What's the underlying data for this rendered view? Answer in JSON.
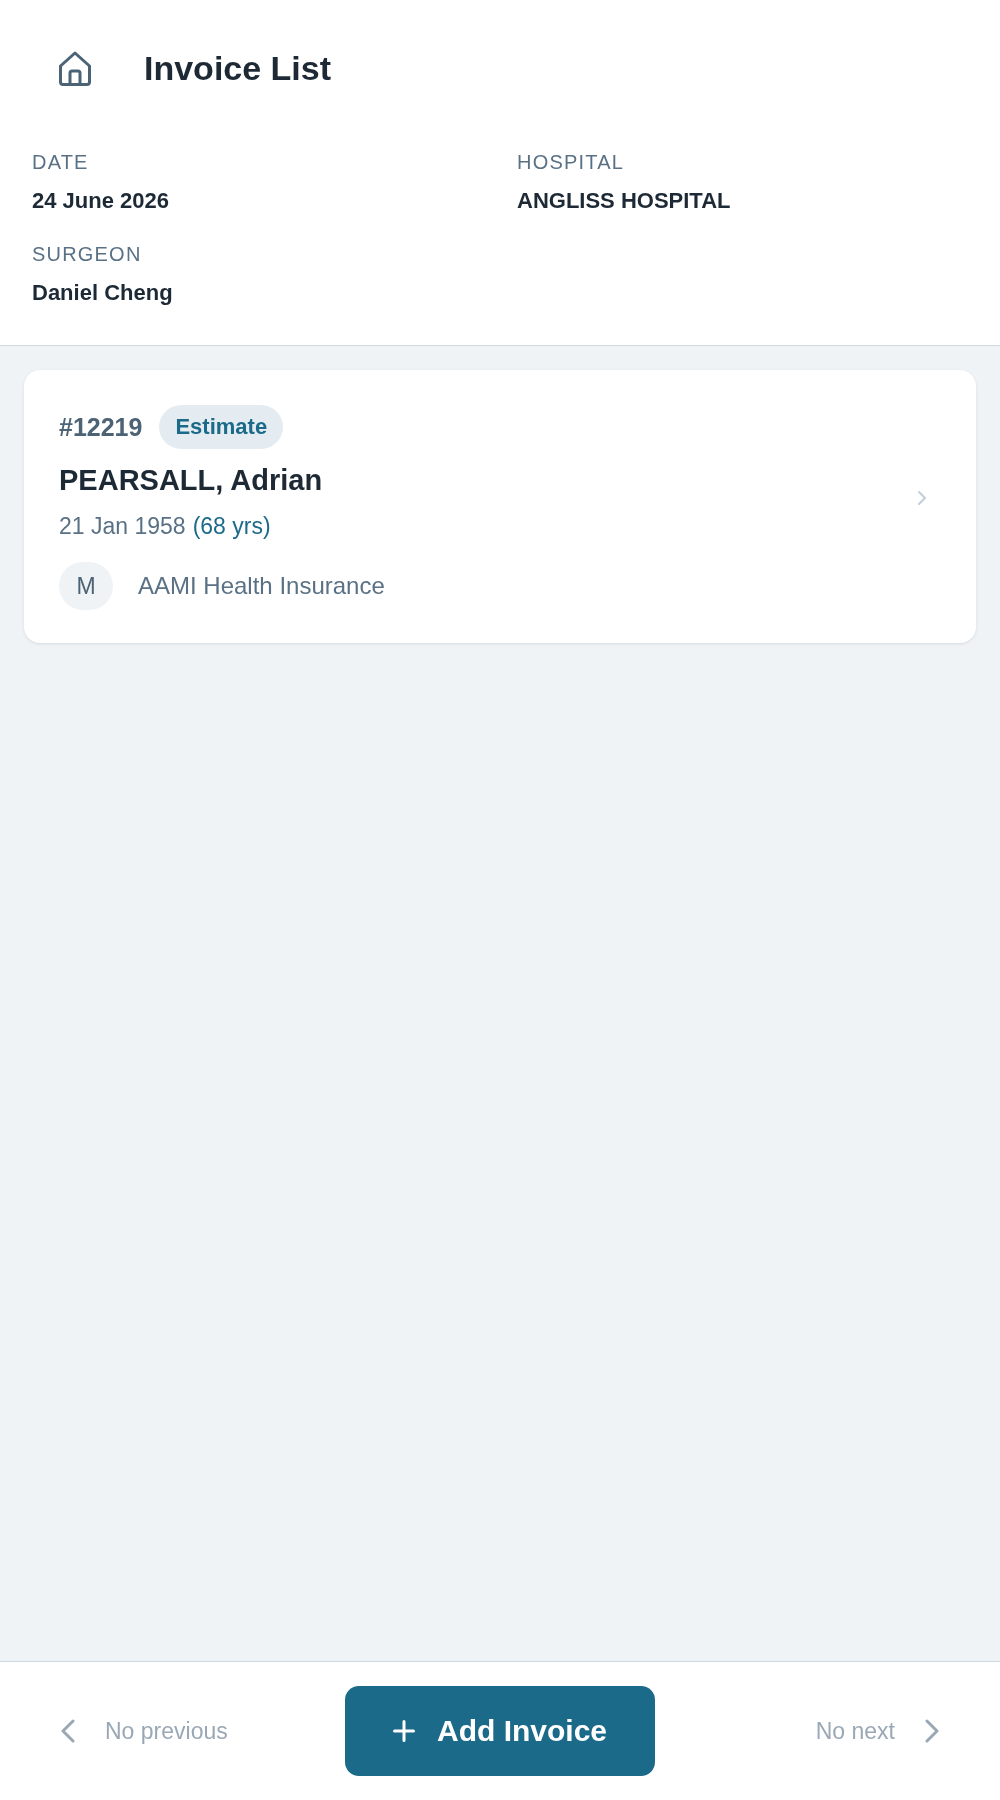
{
  "header": {
    "title": "Invoice List"
  },
  "details": [
    {
      "label": "DATE",
      "value": "24 June 2026"
    },
    {
      "label": "HOSPITAL",
      "value": "ANGLISS HOSPITAL"
    },
    {
      "label": "SURGEON",
      "value": "Daniel Cheng"
    }
  ],
  "invoices": [
    {
      "number": "#12219",
      "status": "Estimate",
      "patient": "PEARSALL, Adrian",
      "dob": "21 Jan 1958",
      "age": "(68 yrs)",
      "insurer_initial": "M",
      "insurer": "AAMI Health Insurance"
    }
  ],
  "footer": {
    "previous": {
      "label": "No previous",
      "disabled": true
    },
    "add_button": "Add Invoice",
    "next": {
      "label": "No next",
      "disabled": true
    }
  }
}
